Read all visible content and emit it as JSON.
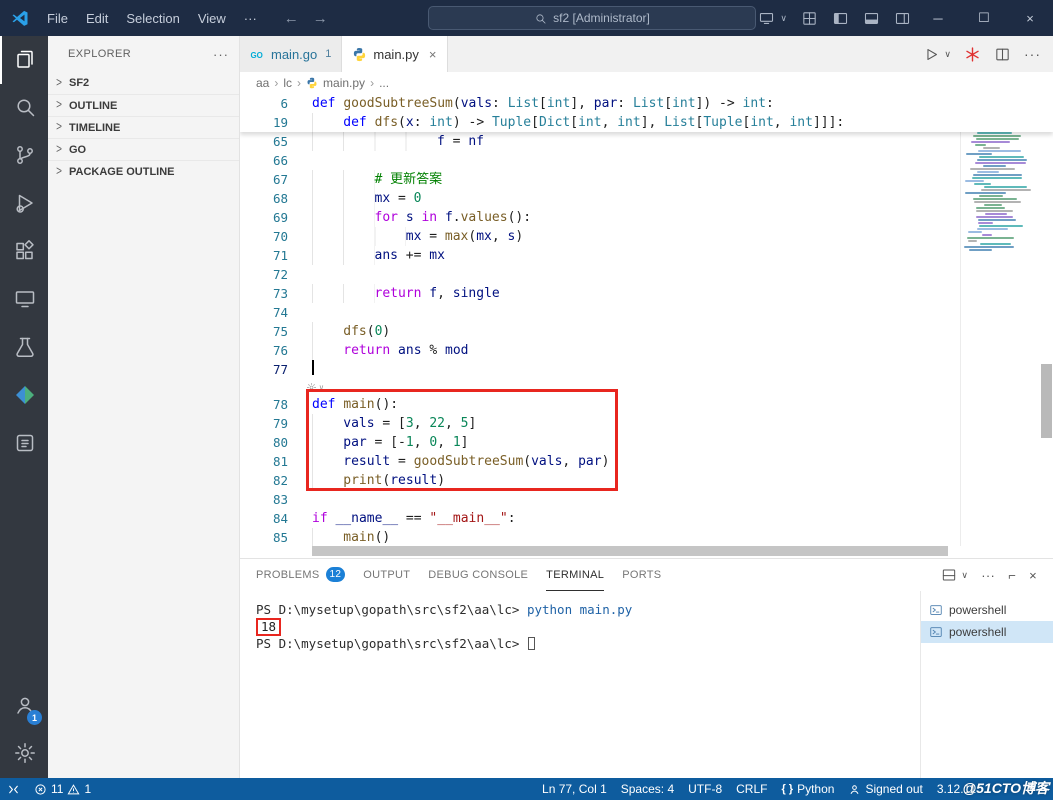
{
  "title_bar": {
    "menus": [
      "File",
      "Edit",
      "Selection",
      "View"
    ],
    "menus_overflow": "···",
    "nav_back": "←",
    "nav_forward": "→",
    "search_text": "sf2 [Administrator]",
    "window": {
      "minimize": "─",
      "maximize": "☐",
      "close": "×"
    }
  },
  "activity_bar": {
    "accounts_badge": "1"
  },
  "sidebar": {
    "header": "EXPLORER",
    "header_more": "···",
    "sections": [
      "SF2",
      "OUTLINE",
      "TIMELINE",
      "GO",
      "PACKAGE OUTLINE"
    ]
  },
  "editor_tabs": {
    "tabs": [
      {
        "label": "main.go",
        "badge": "1"
      },
      {
        "label": "main.py",
        "close": "×"
      }
    ]
  },
  "breadcrumb": {
    "items": [
      "aa",
      "lc",
      "main.py",
      "..."
    ],
    "separator": "›"
  },
  "editor": {
    "sticky_lines": [
      {
        "n": "6",
        "indent": 0,
        "segs": [
          [
            "kw",
            "def "
          ],
          [
            "fn",
            "goodSubtreeSum"
          ],
          [
            "pl",
            "("
          ],
          [
            "var",
            "vals"
          ],
          [
            "pl",
            ": "
          ],
          [
            "type",
            "List"
          ],
          [
            "pl",
            "["
          ],
          [
            "type",
            "int"
          ],
          [
            "pl",
            "], "
          ],
          [
            "var",
            "par"
          ],
          [
            "pl",
            ": "
          ],
          [
            "type",
            "List"
          ],
          [
            "pl",
            "["
          ],
          [
            "type",
            "int"
          ],
          [
            "pl",
            "]) -> "
          ],
          [
            "type",
            "int"
          ],
          [
            "pl",
            ":"
          ]
        ]
      },
      {
        "n": "19",
        "indent": 4,
        "segs": [
          [
            "kw",
            "def "
          ],
          [
            "fn",
            "dfs"
          ],
          [
            "pl",
            "("
          ],
          [
            "var",
            "x"
          ],
          [
            "pl",
            ": "
          ],
          [
            "type",
            "int"
          ],
          [
            "pl",
            ") -> "
          ],
          [
            "type",
            "Tuple"
          ],
          [
            "pl",
            "["
          ],
          [
            "type",
            "Dict"
          ],
          [
            "pl",
            "["
          ],
          [
            "type",
            "int"
          ],
          [
            "pl",
            ", "
          ],
          [
            "type",
            "int"
          ],
          [
            "pl",
            "], "
          ],
          [
            "type",
            "List"
          ],
          [
            "pl",
            "["
          ],
          [
            "type",
            "Tuple"
          ],
          [
            "pl",
            "["
          ],
          [
            "type",
            "int"
          ],
          [
            "pl",
            ", "
          ],
          [
            "type",
            "int"
          ],
          [
            "pl",
            "]]]:"
          ]
        ]
      }
    ],
    "lines": [
      {
        "n": "65",
        "indent": 16,
        "segs": [
          [
            "var",
            "f"
          ],
          [
            "pl",
            " = "
          ],
          [
            "var",
            "nf"
          ]
        ]
      },
      {
        "n": "66",
        "indent": 0,
        "segs": []
      },
      {
        "n": "67",
        "indent": 8,
        "segs": [
          [
            "com",
            "# 更新答案"
          ]
        ]
      },
      {
        "n": "68",
        "indent": 8,
        "segs": [
          [
            "var",
            "mx"
          ],
          [
            "pl",
            " = "
          ],
          [
            "num",
            "0"
          ]
        ]
      },
      {
        "n": "69",
        "indent": 8,
        "segs": [
          [
            "ctrl",
            "for"
          ],
          [
            "pl",
            " "
          ],
          [
            "var",
            "s"
          ],
          [
            "pl",
            " "
          ],
          [
            "ctrl",
            "in"
          ],
          [
            "pl",
            " "
          ],
          [
            "var",
            "f"
          ],
          [
            "pl",
            "."
          ],
          [
            "fn",
            "values"
          ],
          [
            "pl",
            "():"
          ]
        ]
      },
      {
        "n": "70",
        "indent": 12,
        "segs": [
          [
            "var",
            "mx"
          ],
          [
            "pl",
            " = "
          ],
          [
            "fn",
            "max"
          ],
          [
            "pl",
            "("
          ],
          [
            "var",
            "mx"
          ],
          [
            "pl",
            ", "
          ],
          [
            "var",
            "s"
          ],
          [
            "pl",
            ")"
          ]
        ]
      },
      {
        "n": "71",
        "indent": 8,
        "segs": [
          [
            "var",
            "ans"
          ],
          [
            "pl",
            " += "
          ],
          [
            "var",
            "mx"
          ]
        ]
      },
      {
        "n": "72",
        "indent": 0,
        "segs": []
      },
      {
        "n": "73",
        "indent": 8,
        "segs": [
          [
            "ctrl",
            "return"
          ],
          [
            "pl",
            " "
          ],
          [
            "var",
            "f"
          ],
          [
            "pl",
            ", "
          ],
          [
            "var",
            "single"
          ]
        ]
      },
      {
        "n": "74",
        "indent": 0,
        "segs": []
      },
      {
        "n": "75",
        "indent": 4,
        "segs": [
          [
            "fn",
            "dfs"
          ],
          [
            "pl",
            "("
          ],
          [
            "num",
            "0"
          ],
          [
            "pl",
            ")"
          ]
        ]
      },
      {
        "n": "76",
        "indent": 4,
        "segs": [
          [
            "ctrl",
            "return"
          ],
          [
            "pl",
            " "
          ],
          [
            "var",
            "ans"
          ],
          [
            "pl",
            " % "
          ],
          [
            "var",
            "mod"
          ]
        ]
      },
      {
        "n": "77",
        "indent": 0,
        "cursor": true,
        "segs": []
      },
      {
        "widget": true
      },
      {
        "n": "78",
        "indent": 0,
        "segs": [
          [
            "kw",
            "def "
          ],
          [
            "fn",
            "main"
          ],
          [
            "pl",
            "():"
          ]
        ]
      },
      {
        "n": "79",
        "indent": 4,
        "segs": [
          [
            "var",
            "vals"
          ],
          [
            "pl",
            " = ["
          ],
          [
            "num",
            "3"
          ],
          [
            "pl",
            ", "
          ],
          [
            "num",
            "22"
          ],
          [
            "pl",
            ", "
          ],
          [
            "num",
            "5"
          ],
          [
            "pl",
            "]"
          ]
        ]
      },
      {
        "n": "80",
        "indent": 4,
        "segs": [
          [
            "var",
            "par"
          ],
          [
            "pl",
            " = [-"
          ],
          [
            "num",
            "1"
          ],
          [
            "pl",
            ", "
          ],
          [
            "num",
            "0"
          ],
          [
            "pl",
            ", "
          ],
          [
            "num",
            "1"
          ],
          [
            "pl",
            "]"
          ]
        ]
      },
      {
        "n": "81",
        "indent": 4,
        "segs": [
          [
            "var",
            "result"
          ],
          [
            "pl",
            " = "
          ],
          [
            "fn",
            "goodSubtreeSum"
          ],
          [
            "pl",
            "("
          ],
          [
            "var",
            "vals"
          ],
          [
            "pl",
            ", "
          ],
          [
            "var",
            "par"
          ],
          [
            "pl",
            ")"
          ]
        ]
      },
      {
        "n": "82",
        "indent": 4,
        "segs": [
          [
            "fn",
            "print"
          ],
          [
            "pl",
            "("
          ],
          [
            "var",
            "result"
          ],
          [
            "pl",
            ")"
          ]
        ]
      },
      {
        "n": "83",
        "indent": 0,
        "segs": []
      },
      {
        "n": "84",
        "indent": 0,
        "segs": [
          [
            "ctrl",
            "if"
          ],
          [
            "pl",
            " "
          ],
          [
            "var",
            "__name__"
          ],
          [
            "pl",
            " == "
          ],
          [
            "str",
            "\"__main__\""
          ],
          [
            "pl",
            ":"
          ]
        ]
      },
      {
        "n": "85",
        "indent": 4,
        "segs": [
          [
            "fn",
            "main"
          ],
          [
            "pl",
            "()"
          ]
        ]
      }
    ]
  },
  "panel": {
    "tabs": [
      {
        "label": "PROBLEMS",
        "badge": "12"
      },
      {
        "label": "OUTPUT"
      },
      {
        "label": "DEBUG CONSOLE"
      },
      {
        "label": "TERMINAL"
      },
      {
        "label": "PORTS"
      }
    ],
    "terminal": {
      "lines": [
        {
          "segs": [
            [
              "prompt",
              "PS D:\\mysetup\\gopath\\src\\sf2\\aa\\lc> "
            ],
            [
              "cmd",
              "python"
            ],
            [
              "arg",
              " main.py"
            ]
          ]
        },
        {
          "segs": [
            [
              "outbox",
              "18"
            ]
          ]
        },
        {
          "segs": [
            [
              "prompt",
              "PS D:\\mysetup\\gopath\\src\\sf2\\aa\\lc> "
            ]
          ],
          "cursor": true
        }
      ]
    },
    "terminal_list": [
      {
        "label": "powershell"
      },
      {
        "label": "powershell",
        "selected": true
      }
    ]
  },
  "status_bar": {
    "errors": "11",
    "warnings": "1",
    "line_col": "Ln 77, Col 1",
    "spaces": "Spaces: 4",
    "encoding": "UTF-8",
    "eol": "CRLF",
    "language": "Python",
    "account": "Signed out",
    "python_version": "3.12.11",
    "watermark": "@51CTO博客"
  }
}
